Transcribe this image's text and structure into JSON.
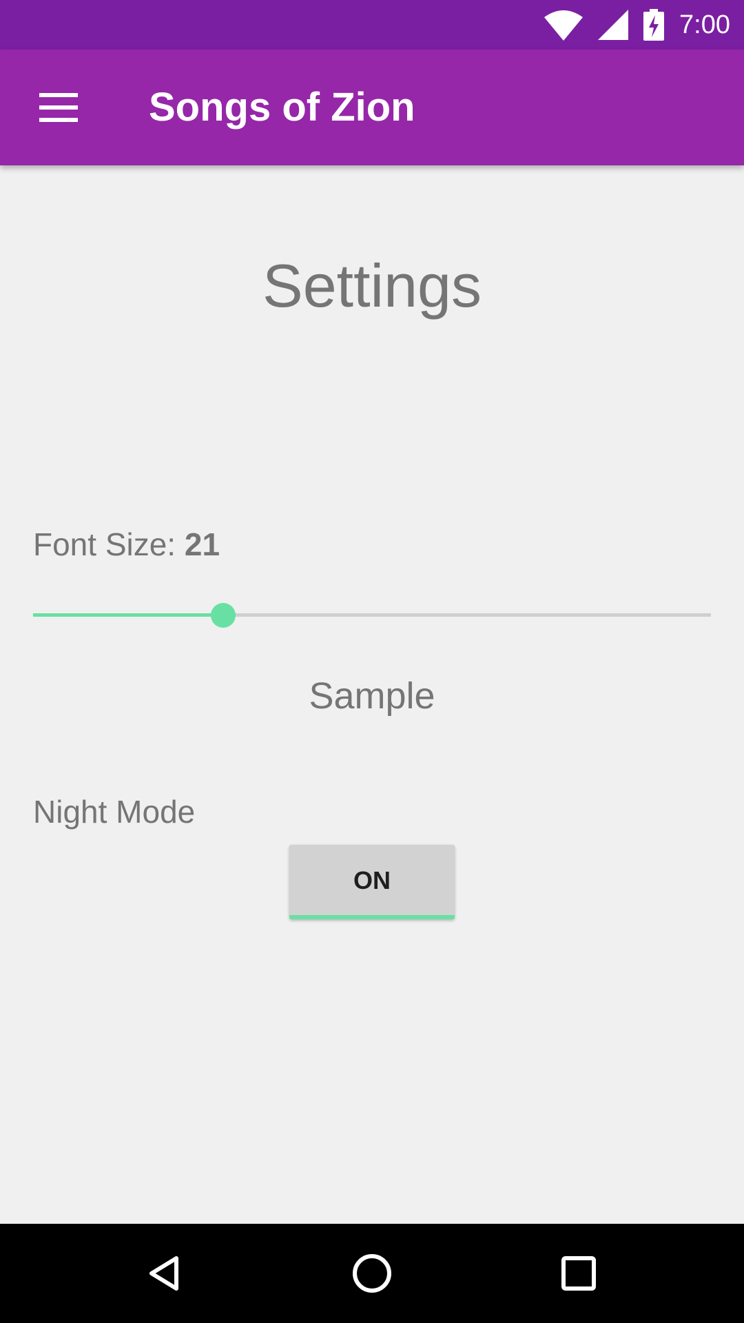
{
  "status_bar": {
    "time": "7:00",
    "icons": [
      "wifi-icon",
      "cell-signal-icon",
      "battery-charging-icon"
    ],
    "background": "#7b1fa2"
  },
  "app_bar": {
    "title": "Songs of Zion",
    "menu_icon": "hamburger-menu-icon",
    "background": "#9627a9"
  },
  "settings": {
    "heading": "Settings",
    "font_size": {
      "label": "Font Size: ",
      "value": "21",
      "slider_fraction": 0.28
    },
    "sample_text": "Sample",
    "night_mode": {
      "label": "Night Mode",
      "toggle_label": "ON",
      "state": "on"
    }
  },
  "colors": {
    "accent": "#69e0a3",
    "text_secondary": "#757575",
    "page_background": "#f0f0f0"
  },
  "nav_bar": {
    "buttons": [
      "back-icon",
      "home-icon",
      "recents-icon"
    ]
  }
}
